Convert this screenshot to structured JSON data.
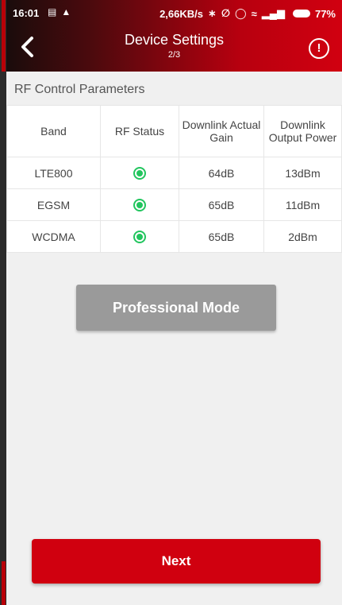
{
  "statusbar": {
    "time": "16:01",
    "left_icons": [
      "image-icon",
      "alert-icon"
    ],
    "speed": "2,66KB/s",
    "battery": "77%",
    "right_icons": [
      "bluetooth-icon",
      "mute-icon",
      "alarm-icon",
      "wifi-icon",
      "signal-icon",
      "battery-icon"
    ]
  },
  "header": {
    "title": "Device Settings",
    "subtitle": "2/3",
    "back_icon": "chevron-left-icon",
    "info_icon": "info-icon",
    "info_glyph": "!",
    "gradient": [
      "#1a0c0c",
      "#d10010"
    ]
  },
  "section": {
    "title": "RF Control Parameters"
  },
  "table": {
    "headers": [
      "Band",
      "RF Status",
      "Downlink Actual Gain",
      "Downlink Output Power"
    ],
    "rows": [
      {
        "band": "LTE800",
        "status": "on",
        "gain": "64dB",
        "power": "13dBm"
      },
      {
        "band": "EGSM",
        "status": "on",
        "gain": "65dB",
        "power": "11dBm"
      },
      {
        "band": "WCDMA",
        "status": "on",
        "gain": "65dB",
        "power": "2dBm"
      }
    ],
    "status_color": "#22c55e"
  },
  "buttons": {
    "professional_mode": "Professional Mode",
    "next": "Next"
  },
  "colors": {
    "accent": "#d0000f",
    "disabled_button": "#9a9a9a"
  }
}
